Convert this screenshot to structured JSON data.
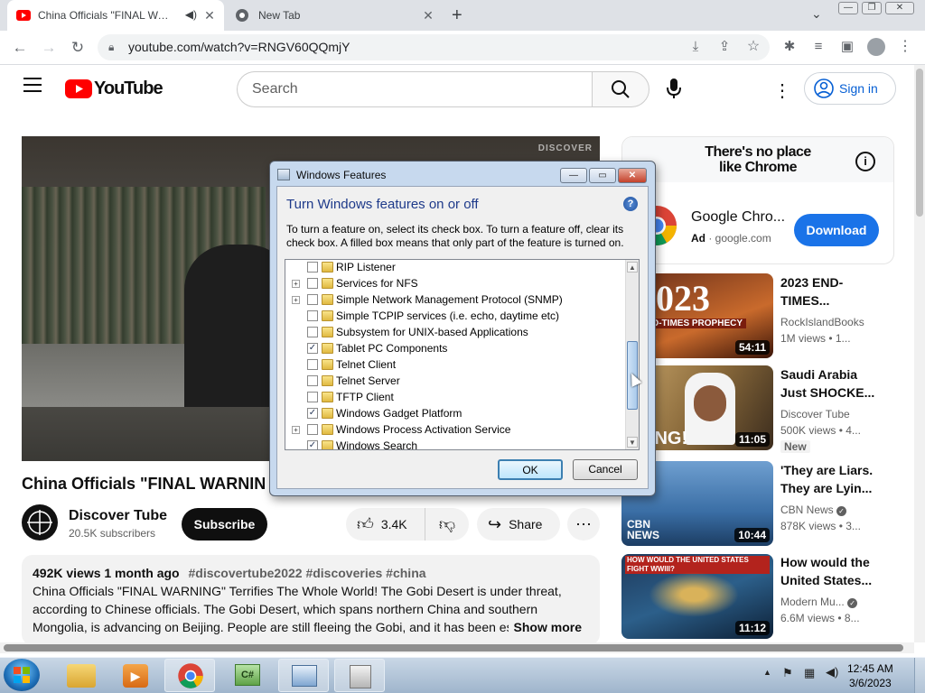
{
  "browser": {
    "tabs": [
      {
        "title": "China Officials \"FINAL WARNI"
      },
      {
        "title": "New Tab"
      }
    ],
    "url": "youtube.com/watch?v=RNGV60QQmjY"
  },
  "yt": {
    "logo_text": "YouTube",
    "search_placeholder": "Search",
    "signin_label": "Sign in",
    "video": {
      "title": "China Officials \"FINAL WARNIN",
      "watermark": "DISCOVER"
    },
    "channel": {
      "name": "Discover Tube",
      "subs": "20.5K subscribers"
    },
    "subscribe_label": "Subscribe",
    "likes": "3.4K",
    "share_label": "Share",
    "description": {
      "meta": "492K views  1 month ago",
      "tags": "#discovertube2022 #discoveries #china",
      "text": "China Officials \"FINAL WARNING\" Terrifies The Whole World! The Gobi Desert is under threat, according to Chinese officials. The Gobi Desert, which spans northern China and southern Mongolia, is advancing on Beijing. People are still fleeing the Gobi, and it has been esti",
      "show_more": "Show more"
    },
    "ad": {
      "headline_1": "There's no place",
      "headline_2": "like Chrome",
      "name": "Google Chro...",
      "ad_label": "Ad",
      "domain": "google.com",
      "download_label": "Download"
    },
    "recs": [
      {
        "title_1": "2023 END-",
        "title_2": "TIMES...",
        "channel": "RockIslandBooks",
        "views": "1M views  • 1...",
        "duration": "54:11",
        "thumb_text_1": "2023",
        "thumb_text_2": "D-TIMES PROPHECY"
      },
      {
        "title_1": "Saudi Arabia",
        "title_2": "Just SHOCKE...",
        "channel": "Discover Tube",
        "views": "500K views  • 4...",
        "badge": "New",
        "duration": "11:05",
        "thumb_text_1": "CKING!"
      },
      {
        "title_1": "'They are Liars.",
        "title_2": "They are Lyin...",
        "channel": "CBN News",
        "views": "878K views  • 3...",
        "duration": "10:44",
        "thumb_text_1": "CBN NEWS"
      },
      {
        "title_1": "How would the",
        "title_2": "United States...",
        "channel": "Modern Mu...",
        "views": "6.6M views  • 8...",
        "duration": "11:12",
        "thumb_text_1": "HOW WOULD THE UNITED STATES FIGHT WWIII?"
      }
    ]
  },
  "dialog": {
    "title": "Windows Features",
    "heading": "Turn Windows features on or off",
    "description": "To turn a feature on, select its check box. To turn a feature off, clear its check box. A filled box means that only part of the feature is turned on.",
    "features": [
      {
        "label": "RIP Listener",
        "checked": false,
        "expandable": false
      },
      {
        "label": "Services for NFS",
        "checked": false,
        "expandable": true
      },
      {
        "label": "Simple Network Management Protocol (SNMP)",
        "checked": false,
        "expandable": true
      },
      {
        "label": "Simple TCPIP services (i.e. echo, daytime etc)",
        "checked": false,
        "expandable": false
      },
      {
        "label": "Subsystem for UNIX-based Applications",
        "checked": false,
        "expandable": false
      },
      {
        "label": "Tablet PC Components",
        "checked": true,
        "expandable": false
      },
      {
        "label": "Telnet Client",
        "checked": false,
        "expandable": false
      },
      {
        "label": "Telnet Server",
        "checked": false,
        "expandable": false
      },
      {
        "label": "TFTP Client",
        "checked": false,
        "expandable": false
      },
      {
        "label": "Windows Gadget Platform",
        "checked": true,
        "expandable": false
      },
      {
        "label": "Windows Process Activation Service",
        "checked": false,
        "expandable": true
      },
      {
        "label": "Windows Search",
        "checked": true,
        "expandable": false
      }
    ],
    "ok_label": "OK",
    "cancel_label": "Cancel"
  },
  "taskbar": {
    "time": "12:45 AM",
    "date": "3/6/2023"
  },
  "colors": {
    "yt_red": "#ff0000",
    "chrome_blue": "#1a73e8",
    "dialog_heading": "#1e3a8a"
  }
}
